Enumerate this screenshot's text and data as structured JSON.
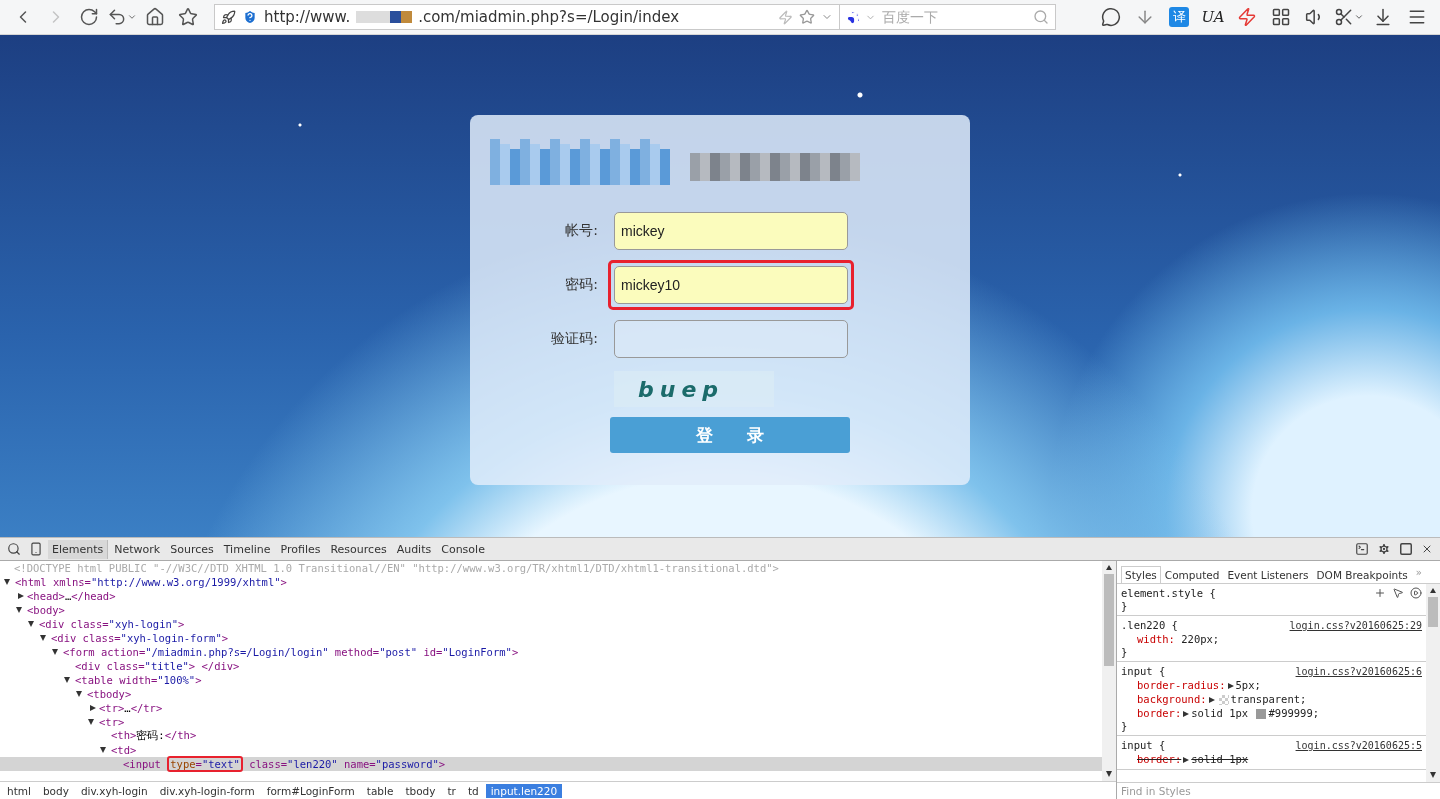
{
  "browser": {
    "nav_buttons": [
      {
        "kind": "back",
        "disabled": false
      },
      {
        "kind": "forward",
        "disabled": true
      },
      {
        "kind": "reload",
        "disabled": false
      },
      {
        "kind": "undo",
        "disabled": false
      },
      {
        "kind": "home",
        "disabled": false
      },
      {
        "kind": "bookmark",
        "disabled": false
      }
    ],
    "address": {
      "url_prefix": "http://www.",
      "url_suffix": ".com/miadmin.php?s=/Login/index"
    },
    "search": {
      "placeholder": "百度一下"
    },
    "extensions": [
      {
        "kind": "chat"
      },
      {
        "kind": "blocked-download"
      },
      {
        "kind": "translate",
        "label": "译"
      },
      {
        "kind": "ua",
        "label": "UA"
      },
      {
        "kind": "lightning"
      },
      {
        "kind": "grid"
      },
      {
        "kind": "speaker"
      },
      {
        "kind": "scissors"
      },
      {
        "kind": "save"
      },
      {
        "kind": "menu"
      }
    ]
  },
  "login": {
    "fields": [
      {
        "label": "帐号:",
        "value": "mickey",
        "autofilled": true,
        "annotated": false
      },
      {
        "label": "密码:",
        "value": "mickey10",
        "autofilled": true,
        "annotated": true
      },
      {
        "label": "验证码:",
        "autofilled": false,
        "annotated": false
      }
    ],
    "captcha": "buep",
    "button": "登 录"
  },
  "devtools": {
    "tabs": [
      {
        "label": "Elements",
        "selected": true
      },
      {
        "label": "Network",
        "selected": false
      },
      {
        "label": "Sources",
        "selected": false
      },
      {
        "label": "Timeline",
        "selected": false
      },
      {
        "label": "Profiles",
        "selected": false
      },
      {
        "label": "Resources",
        "selected": false
      },
      {
        "label": "Audits",
        "selected": false
      },
      {
        "label": "Console",
        "selected": false
      }
    ],
    "doctype": "<!DOCTYPE html PUBLIC \"-//W3C//DTD XHTML 1.0 Transitional//EN\" \"http://www.w3.org/TR/xhtml1/DTD/xhtml1-transitional.dtd\">",
    "tree": [
      {
        "text": "<html xmlns=\"http://www.w3.org/1999/xhtml\">",
        "expanded": true,
        "selected": false,
        "children": [
          {
            "text": "<head>…</head>",
            "expanded": false,
            "selected": false
          },
          {
            "text": "<body>",
            "expanded": true,
            "selected": false,
            "children": [
              {
                "text": "<div class=\"xyh-login\">",
                "expanded": true,
                "selected": false,
                "children": [
                  {
                    "text": "<div class=\"xyh-login-form\">",
                    "expanded": true,
                    "selected": false,
                    "children": [
                      {
                        "text": "<form action=\"/miadmin.php?s=/Login/login\" method=\"post\" id=\"LoginForm\">",
                        "expanded": true,
                        "selected": false,
                        "children": [
                          {
                            "text": "<div class=\"title\"> </div>",
                            "selected": false
                          },
                          {
                            "text": "<table width=\"100%\">",
                            "expanded": true,
                            "selected": false,
                            "children": [
                              {
                                "text": "<tbody>",
                                "expanded": true,
                                "selected": false,
                                "children": [
                                  {
                                    "text": "<tr>…</tr>",
                                    "expanded": false,
                                    "selected": false
                                  },
                                  {
                                    "text": "<tr>",
                                    "expanded": true,
                                    "selected": false,
                                    "children": [
                                      {
                                        "text": "<th>密码:</th>",
                                        "selected": false
                                      },
                                      {
                                        "text": "<td>",
                                        "expanded": true,
                                        "selected": false,
                                        "children": [
                                          {
                                            "text": "<input ",
                                            "boxed_text": "type=\"text\"",
                                            "text_after": " class=\"len220\" name=\"password\">",
                                            "selected": true
                                          }
                                        ]
                                      }
                                    ]
                                  }
                                ]
                              }
                            ]
                          }
                        ]
                      }
                    ]
                  }
                ]
              }
            ]
          }
        ]
      }
    ],
    "breadcrumbs": [
      {
        "label": "html",
        "selected": false
      },
      {
        "label": "body",
        "selected": false
      },
      {
        "label": "div.xyh-login",
        "selected": false
      },
      {
        "label": "div.xyh-login-form",
        "selected": false
      },
      {
        "label": "form#LoginForm",
        "selected": false
      },
      {
        "label": "table",
        "selected": false
      },
      {
        "label": "tbody",
        "selected": false
      },
      {
        "label": "tr",
        "selected": false
      },
      {
        "label": "td",
        "selected": false
      },
      {
        "label": "input.len220",
        "selected": true
      }
    ],
    "styles": {
      "tabs": [
        {
          "label": "Styles",
          "selected": true
        },
        {
          "label": "Computed",
          "selected": false
        },
        {
          "label": "Event Listeners",
          "selected": false
        },
        {
          "label": "DOM Breakpoints",
          "selected": false
        }
      ],
      "more": "»",
      "rules": [
        {
          "selector": "element.style {",
          "close": "}",
          "tools": true
        },
        {
          "selector": ".len220 {",
          "source": "login.css?v20160625:29",
          "close": "}",
          "declarations": [
            {
              "property": "width:",
              "value": "220px;",
              "expandable": false,
              "overridden": false
            }
          ]
        },
        {
          "selector": "input {",
          "source": "login.css?v20160625:6",
          "close": "}",
          "declarations": [
            {
              "property": "border-radius:",
              "value": "5px;",
              "expandable": true,
              "overridden": false
            },
            {
              "property": "background:",
              "swatch": true,
              "value": "transparent;",
              "expandable": true,
              "overridden": false
            },
            {
              "property": "border:",
              "value_before": "solid 1px",
              "swatch": true,
              "value": "#999999;",
              "expandable": true,
              "overridden": false
            }
          ]
        },
        {
          "selector": "input {",
          "source": "login.css?v20160625:5",
          "declarations": [
            {
              "property": "border:",
              "value": "solid 1px",
              "expandable": true,
              "overridden": true
            }
          ]
        }
      ],
      "find_placeholder": "Find in Styles"
    }
  }
}
